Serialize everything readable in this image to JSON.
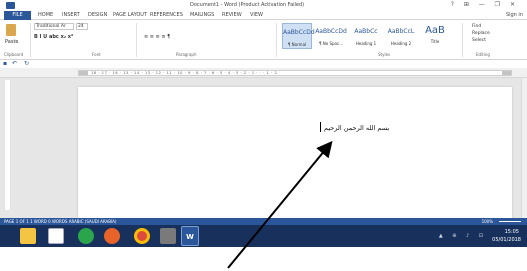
{
  "window": {
    "title": "Document1 - Word (Product Activation Failed)",
    "controls": "?  ⊞  —  ❐  ✕"
  },
  "tabs": [
    {
      "label": "FILE"
    },
    {
      "label": "HOME"
    },
    {
      "label": "INSERT"
    },
    {
      "label": "DESIGN"
    },
    {
      "label": "PAGE LAYOUT"
    },
    {
      "label": "REFERENCES"
    },
    {
      "label": "MAILINGS"
    },
    {
      "label": "REVIEW"
    },
    {
      "label": "VIEW"
    }
  ],
  "sign_in": "Sign in",
  "ribbon": {
    "paste_label": "Paste",
    "font_name": "Traditional Ar",
    "font_size": "24",
    "format_row": "B  I  U  abc  x₂  x²",
    "para_row": "≡ ≡ ≡ ≡  ¶",
    "styles": [
      {
        "sample": "AaBbCcDd",
        "name": "¶ Normal"
      },
      {
        "sample": "AaBbCcDd",
        "name": "¶ No Spac..."
      },
      {
        "sample": "AaBbCc",
        "name": "Heading 1"
      },
      {
        "sample": "AaBbCcL",
        "name": "Heading 2"
      },
      {
        "sample": "AaB",
        "name": "Title"
      }
    ],
    "editing": [
      "Find",
      "Replace",
      "Select"
    ],
    "groups": {
      "clipboard": "Clipboard",
      "font": "Font",
      "paragraph": "Paragraph",
      "styles": "Styles",
      "editing": "Editing"
    }
  },
  "ruler": {
    "ticks": "18 · 17 · 16 · 15 · 14 · 13 · 12 · 11 · 10 · 9 · 8 · 7 · 6 · 5 · 4 · 3 · 2 · 1 · · · 1 · 2"
  },
  "document": {
    "text": "بسم الله الرحمن الرحيم"
  },
  "status": {
    "left": "PAGE 1 OF 1   1 WORD   0 WORDS   ARABIC (SAUDI ARABIA)",
    "right": "100%"
  },
  "taskbar": {
    "word_label": "W",
    "tray": "▲  ⊕  ♪  ⊡",
    "time": "15:05",
    "date": "05/01/2018"
  },
  "colors": {
    "accent": "#2b579a",
    "taskbar": "#18315c"
  }
}
